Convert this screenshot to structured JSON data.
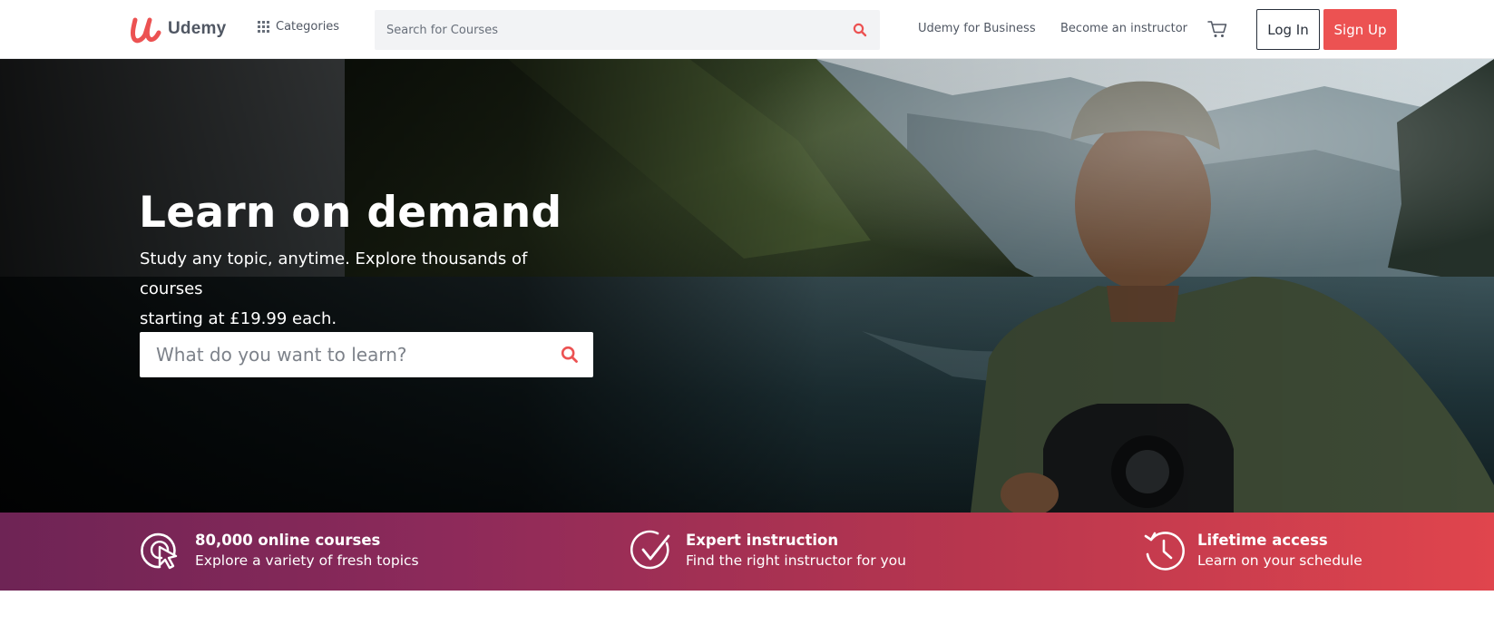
{
  "header": {
    "logo_text": "Udemy",
    "categories_label": "Categories",
    "search_placeholder": "Search for Courses",
    "links": {
      "business": "Udemy for Business",
      "instructor": "Become an instructor"
    },
    "login_label": "Log In",
    "signup_label": "Sign Up",
    "icons": {
      "grid": "grid-icon",
      "search": "search-icon",
      "cart": "cart-icon"
    }
  },
  "hero": {
    "title": "Learn on demand",
    "subtitle_line1": "Study any topic, anytime. Explore thousands of courses",
    "subtitle_line2": "starting at £19.99 each.",
    "search_placeholder": "What do you want to learn?"
  },
  "value_props": [
    {
      "icon": "cursor-click-icon",
      "title": "80,000 online courses",
      "desc": "Explore a variety of fresh topics"
    },
    {
      "icon": "checkmark-icon",
      "title": "Expert instruction",
      "desc": "Find the right instructor for you"
    },
    {
      "icon": "clock-history-icon",
      "title": "Lifetime access",
      "desc": "Learn on your schedule"
    }
  ],
  "colors": {
    "brand": "#ec5252",
    "text": "#29303b",
    "strip_start": "#6e2455",
    "strip_end": "#e0454d"
  }
}
